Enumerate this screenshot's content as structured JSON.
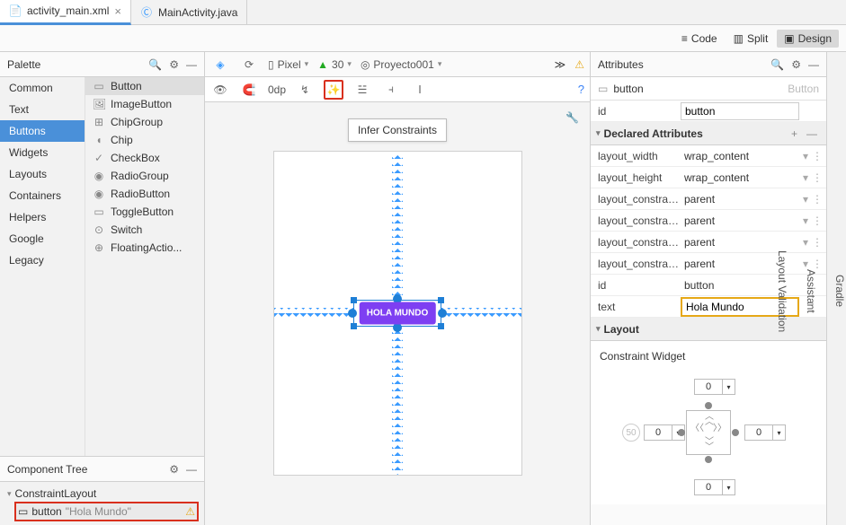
{
  "tabs": [
    {
      "label": "activity_main.xml",
      "icon": "layout-file"
    },
    {
      "label": "MainActivity.java",
      "icon": "java-class"
    }
  ],
  "view_modes": {
    "code": "Code",
    "split": "Split",
    "design": "Design"
  },
  "right_rail": [
    "Gradle",
    "Assistant",
    "Layout Validation"
  ],
  "palette": {
    "title": "Palette",
    "categories": [
      "Common",
      "Text",
      "Buttons",
      "Widgets",
      "Layouts",
      "Containers",
      "Helpers",
      "Google",
      "Legacy"
    ],
    "selected_category": "Buttons",
    "widgets": [
      "Button",
      "ImageButton",
      "ChipGroup",
      "Chip",
      "CheckBox",
      "RadioGroup",
      "RadioButton",
      "ToggleButton",
      "Switch",
      "FloatingActio..."
    ]
  },
  "component_tree": {
    "title": "Component Tree",
    "root": "ConstraintLayout",
    "child": {
      "name": "button",
      "text": "\"Hola Mundo\""
    }
  },
  "designer": {
    "device": "Pixel",
    "api": "30",
    "theme": "Proyecto001",
    "margin": "0dp",
    "tooltip": "Infer Constraints",
    "button_text": "HOLA MUNDO"
  },
  "attributes": {
    "title": "Attributes",
    "selected": "button",
    "selected_class": "Button",
    "id_value": "button",
    "declared_title": "Declared Attributes",
    "layout_title": "Layout",
    "cw_title": "Constraint Widget",
    "rows": [
      {
        "k": "id",
        "v": "button",
        "input": true
      },
      {
        "k": "layout_width",
        "v": "wrap_content",
        "dd": true
      },
      {
        "k": "layout_height",
        "v": "wrap_content",
        "dd": true
      },
      {
        "k": "layout_constrain...",
        "v": "parent",
        "dd": true
      },
      {
        "k": "layout_constrain...",
        "v": "parent",
        "dd": true
      },
      {
        "k": "layout_constrain...",
        "v": "parent",
        "dd": true
      },
      {
        "k": "layout_constrain...",
        "v": "parent",
        "dd": true
      },
      {
        "k": "id",
        "v": "button",
        "plain": true
      },
      {
        "k": "text",
        "v": "Hola Mundo",
        "input": true,
        "hl": true
      }
    ],
    "cw_values": {
      "top": "0",
      "bottom": "0",
      "left": "0",
      "right": "0",
      "bias": "50"
    }
  }
}
